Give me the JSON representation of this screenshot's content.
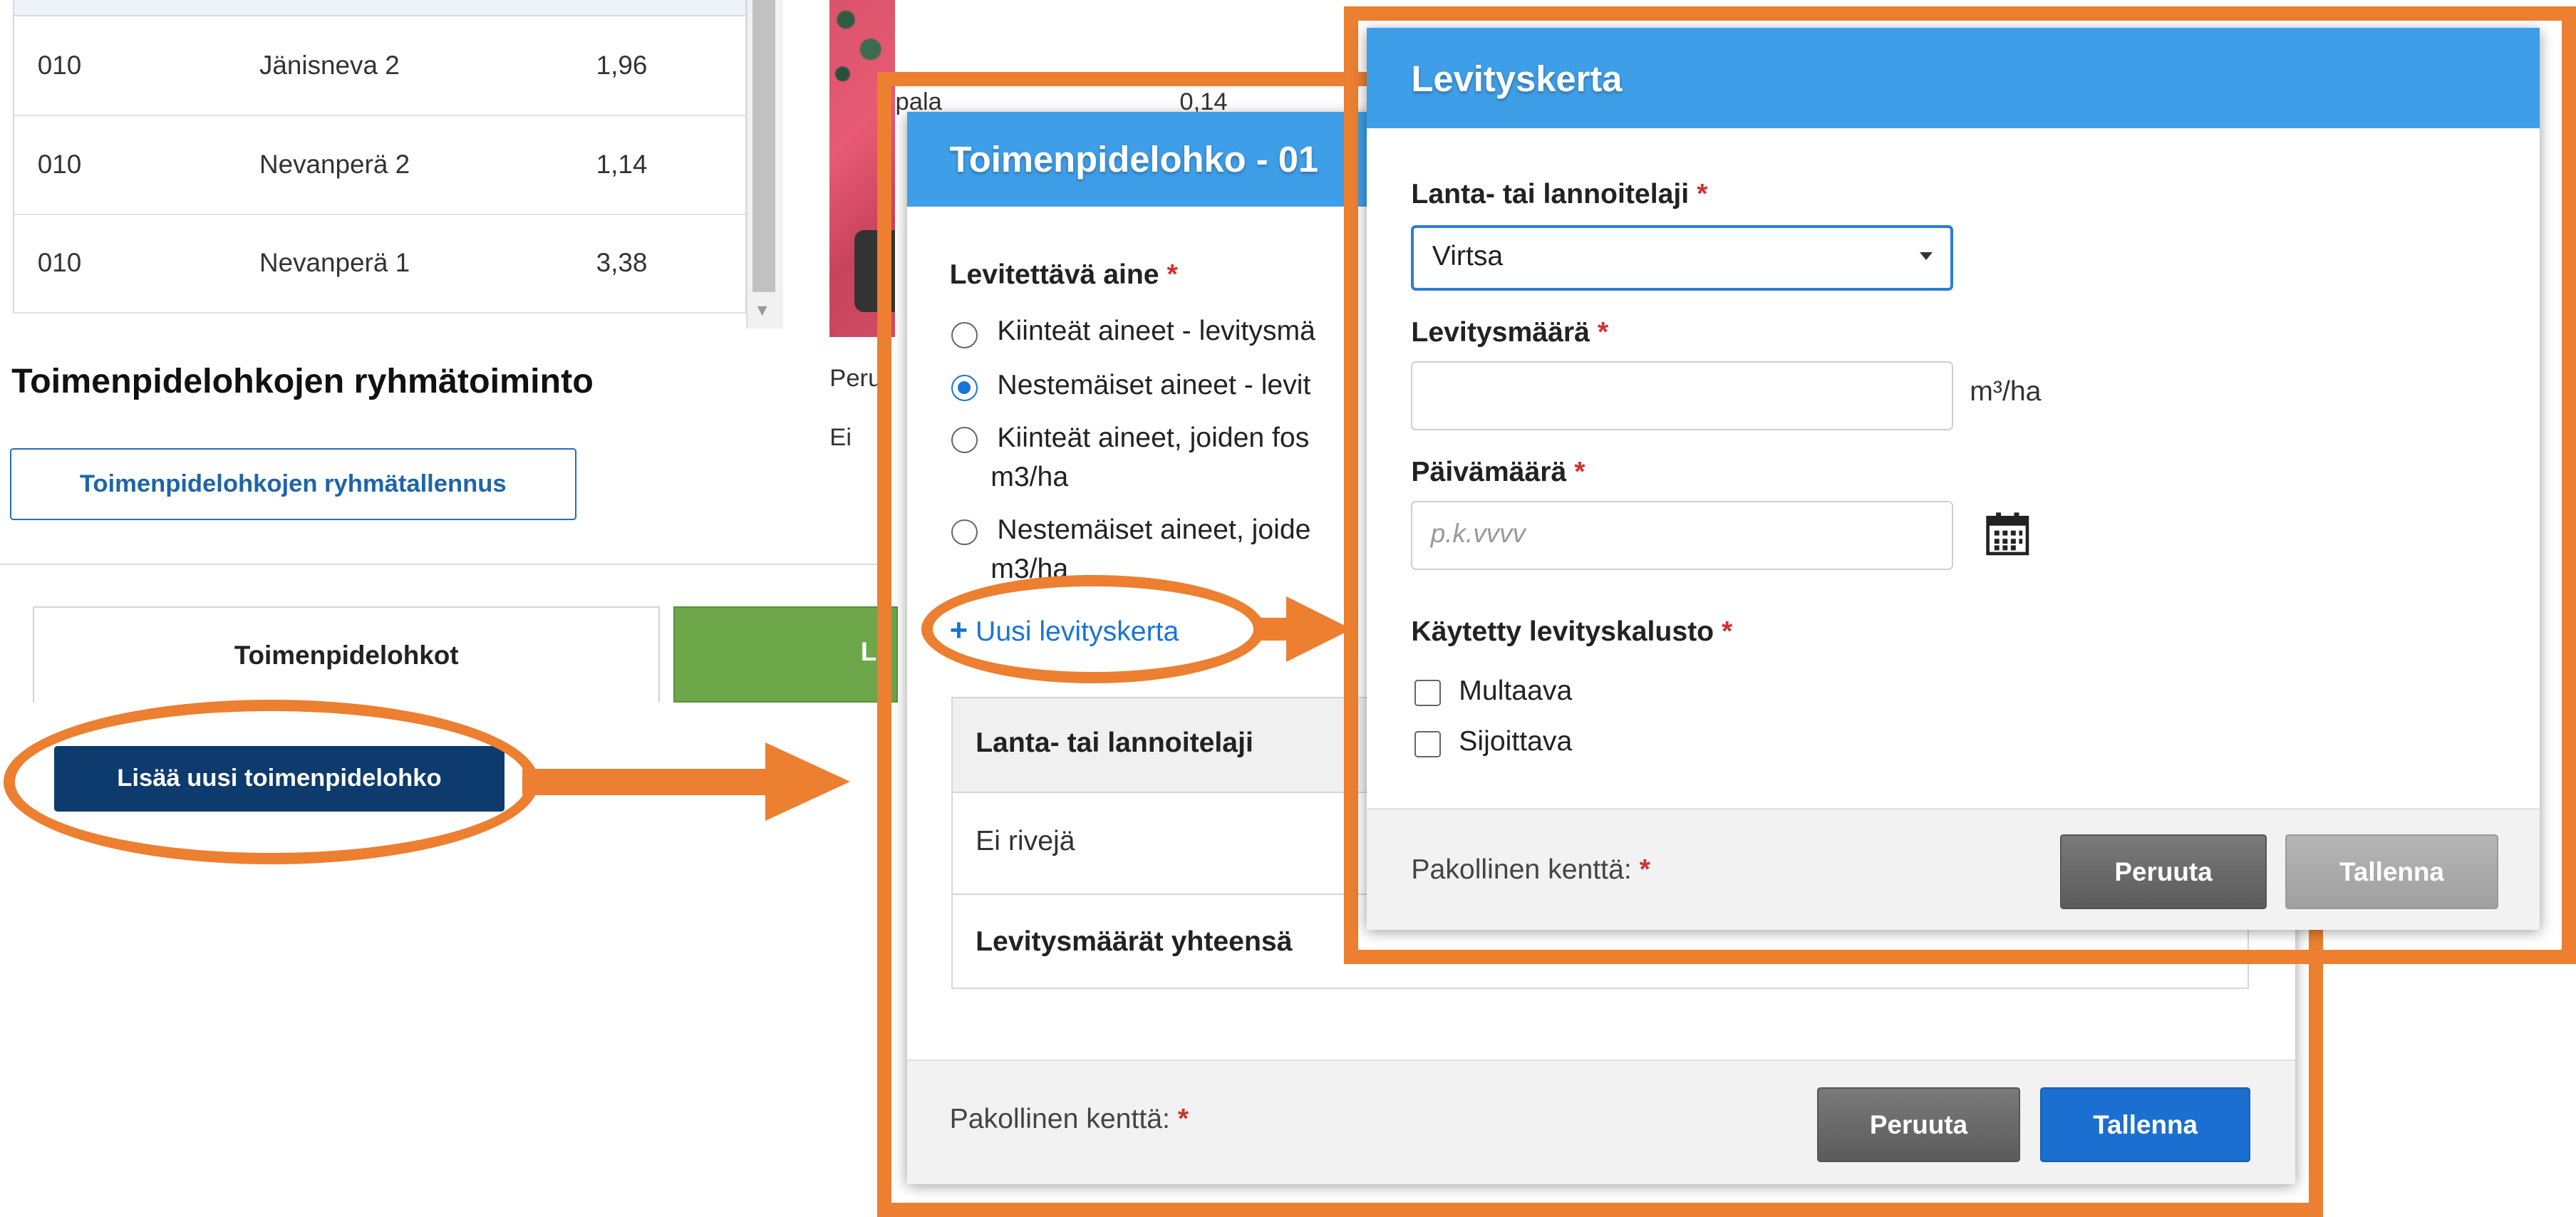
{
  "background": {
    "table_rows": [
      {
        "code": "010",
        "name": "Jänisneva 2",
        "area": "1,96"
      },
      {
        "code": "010",
        "name": "Nevanperä 2",
        "area": "1,14"
      },
      {
        "code": "010",
        "name": "Nevanperä 1",
        "area": "3,38"
      }
    ],
    "group_title": "Toimenpidelohkojen ryhmätoiminto",
    "group_save_button": "Toimenpidelohkojen ryhmätallennus",
    "tab_active": "Toimenpidelohkot",
    "tab_green_fragment": "L",
    "add_button": "Lisää uusi toimenpidelohko",
    "map_fragments": {
      "pala": "pala",
      "value": "0,14",
      "peru": "Peru",
      "ei": "Ei"
    }
  },
  "dialog1": {
    "title": "Toimenpidelohko - 01",
    "section_label": "Levitettävä aine",
    "options": [
      {
        "label": "Kiinteät aineet - levitysmä",
        "selected": false
      },
      {
        "label": "Nestemäiset aineet - levit",
        "selected": true
      },
      {
        "label": "Kiinteät aineet, joiden fos",
        "line2": "m3/ha",
        "selected": false
      },
      {
        "label": "Nestemäiset aineet, joide",
        "line2": "m3/ha",
        "selected": false
      }
    ],
    "add_link": "Uusi levityskerta",
    "table": {
      "header": "Lanta- tai lannoitelaji",
      "empty": "Ei rivejä",
      "total": "Levitysmäärät yhteensä"
    },
    "footer_text": "Pakollinen kenttä:",
    "cancel": "Peruuta",
    "save": "Tallenna"
  },
  "dialog2": {
    "title": "Levityskerta",
    "fertilizer_label": "Lanta- tai lannoitelaji",
    "fertilizer_value": "Virtsa",
    "amount_label": "Levitysmäärä",
    "amount_unit": "m³/ha",
    "date_label": "Päivämäärä",
    "date_placeholder": "p.k.vvvv",
    "equipment_label": "Käytetty levityskalusto",
    "equipment": [
      "Multaava",
      "Sijoittava"
    ],
    "footer_text": "Pakollinen kenttä:",
    "cancel": "Peruuta",
    "save": "Tallenna"
  },
  "required_mark": "*",
  "colors": {
    "annotation": "#ec7f30",
    "header_blue": "#3f9ee8",
    "primary": "#1a6fd0",
    "navy": "#0d3b6e"
  }
}
